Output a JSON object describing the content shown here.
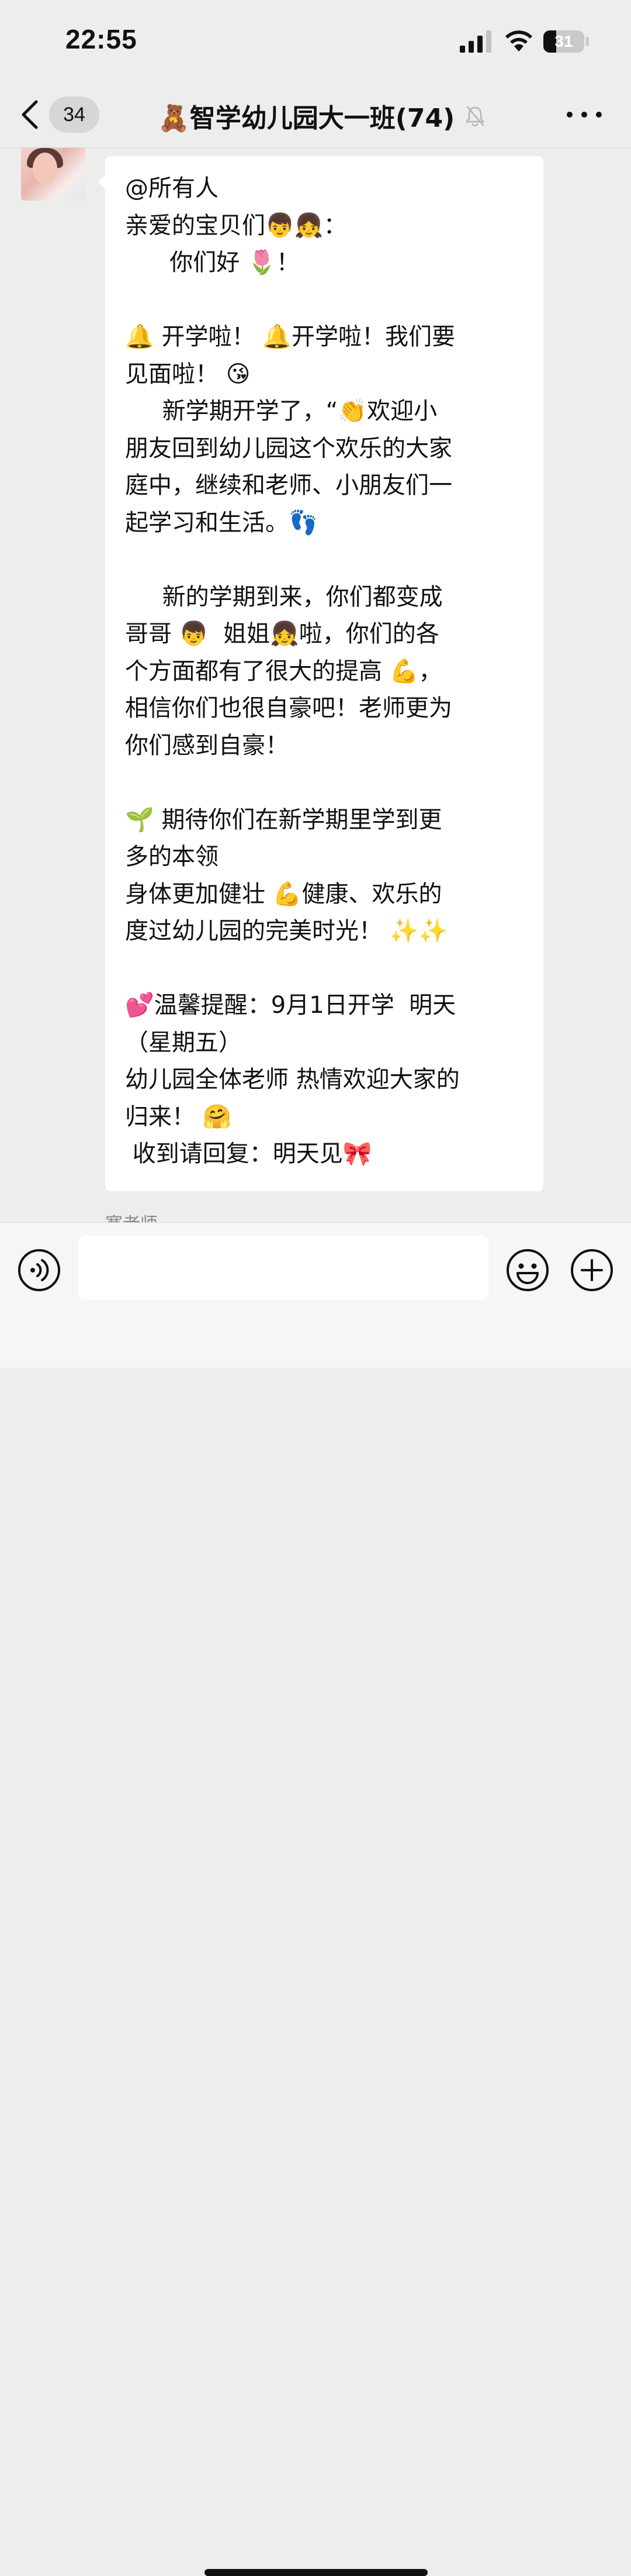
{
  "status_bar": {
    "time": "22:55",
    "battery_level": "31",
    "icons": [
      "signal-icon",
      "wifi-icon",
      "battery-icon"
    ]
  },
  "nav": {
    "back_icon": "chevron-left-icon",
    "unread_count": "34",
    "title": "🧸智学幼儿园大一班(74)",
    "mute_icon": "bell-slash-icon",
    "more_icon": "more-dots-icon"
  },
  "message": {
    "lines": [
      "@所有人",
      "亲爱的宝贝们👦👧：",
      "      你们好 🌷！",
      "",
      "🔔 开学啦！ 🔔开学啦！我们要",
      "见面啦！ 😘",
      "     新学期开学了，“👏欢迎小",
      "朋友回到幼儿园这个欢乐的大家",
      "庭中，继续和老师、小朋友们一",
      "起学习和生活。👣",
      "",
      "     新的学期到来，你们都变成",
      "哥哥 👦  姐姐👧啦，你们的各",
      "个方面都有了很大的提高 💪，",
      "相信你们也很自豪吧！老师更为",
      "你们感到自豪！",
      "",
      "🌱 期待你们在新学期里学到更",
      "多的本领",
      "身体更加健壮 💪健康、欢乐的",
      "度过幼儿园的完美时光！ ✨✨",
      "",
      "💕温馨提醒：9月1日开学  明天",
      "（星期五）",
      "幼儿园全体老师 热情欢迎大家的",
      "归来！ 🤗",
      " 收到请回复：明天见🎀"
    ]
  },
  "next_message": {
    "sender": "寒老师"
  },
  "input_bar": {
    "text_value": "",
    "voice_icon": "voice-icon",
    "emoji_icon": "emoji-icon",
    "plus_icon": "plus-icon"
  },
  "colors": {
    "background": "#ededed",
    "bubble": "#ffffff",
    "text": "#111111",
    "badge": "#d6d6d6"
  }
}
